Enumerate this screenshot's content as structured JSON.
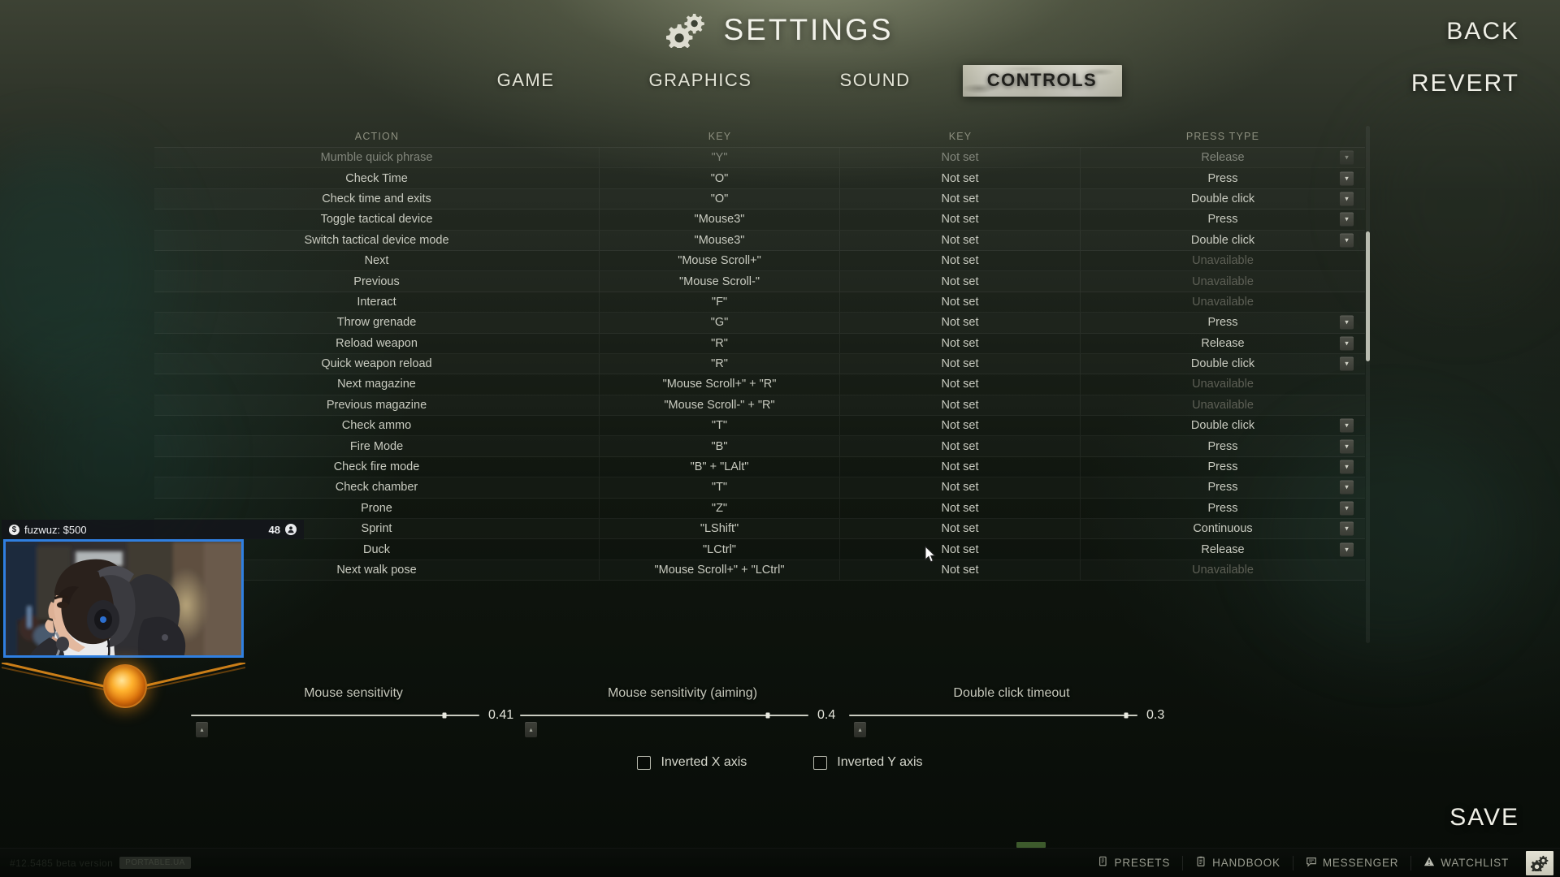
{
  "header": {
    "title": "SETTINGS",
    "gear_icon": "gears-icon"
  },
  "tabs": [
    {
      "label": "GAME",
      "active": false
    },
    {
      "label": "GRAPHICS",
      "active": false
    },
    {
      "label": "SOUND",
      "active": false
    },
    {
      "label": "CONTROLS",
      "active": true
    }
  ],
  "corner_buttons": {
    "back": "BACK",
    "revert": "REVERT",
    "save": "SAVE"
  },
  "table": {
    "columns": [
      "ACTION",
      "KEY",
      "KEY",
      "PRESS TYPE"
    ],
    "not_set_label": "Not set",
    "unavailable_label": "Unavailable",
    "rows": [
      {
        "action": "Mumble quick phrase",
        "key1": "\"Y\"",
        "key2": "Not set",
        "press": "Release",
        "available": true
      },
      {
        "action": "Check Time",
        "key1": "\"O\"",
        "key2": "Not set",
        "press": "Press",
        "available": true
      },
      {
        "action": "Check time and exits",
        "key1": "\"O\"",
        "key2": "Not set",
        "press": "Double click",
        "available": true
      },
      {
        "action": "Toggle tactical device",
        "key1": "\"Mouse3\"",
        "key2": "Not set",
        "press": "Press",
        "available": true
      },
      {
        "action": "Switch tactical device mode",
        "key1": "\"Mouse3\"",
        "key2": "Not set",
        "press": "Double click",
        "available": true
      },
      {
        "action": "Next",
        "key1": "\"Mouse Scroll+\"",
        "key2": "Not set",
        "press": "Unavailable",
        "available": false
      },
      {
        "action": "Previous",
        "key1": "\"Mouse Scroll-\"",
        "key2": "Not set",
        "press": "Unavailable",
        "available": false
      },
      {
        "action": "Interact",
        "key1": "\"F\"",
        "key2": "Not set",
        "press": "Unavailable",
        "available": false
      },
      {
        "action": "Throw grenade",
        "key1": "\"G\"",
        "key2": "Not set",
        "press": "Press",
        "available": true
      },
      {
        "action": "Reload weapon",
        "key1": "\"R\"",
        "key2": "Not set",
        "press": "Release",
        "available": true
      },
      {
        "action": "Quick weapon reload",
        "key1": "\"R\"",
        "key2": "Not set",
        "press": "Double click",
        "available": true
      },
      {
        "action": "Next magazine",
        "key1": "\"Mouse Scroll+\" + \"R\"",
        "key2": "Not set",
        "press": "Unavailable",
        "available": false
      },
      {
        "action": "Previous magazine",
        "key1": "\"Mouse Scroll-\" + \"R\"",
        "key2": "Not set",
        "press": "Unavailable",
        "available": false
      },
      {
        "action": "Check ammo",
        "key1": "\"T\"",
        "key2": "Not set",
        "press": "Double click",
        "available": true
      },
      {
        "action": "Fire Mode",
        "key1": "\"B\"",
        "key2": "Not set",
        "press": "Press",
        "available": true
      },
      {
        "action": "Check fire mode",
        "key1": "\"B\" + \"LAlt\"",
        "key2": "Not set",
        "press": "Press",
        "available": true
      },
      {
        "action": "Check chamber",
        "key1": "\"T\"",
        "key2": "Not set",
        "press": "Press",
        "available": true
      },
      {
        "action": "Prone",
        "key1": "\"Z\"",
        "key2": "Not set",
        "press": "Press",
        "available": true
      },
      {
        "action": "Sprint",
        "key1": "\"LShift\"",
        "key2": "Not set",
        "press": "Continuous",
        "available": true
      },
      {
        "action": "Duck",
        "key1": "\"LCtrl\"",
        "key2": "Not set",
        "press": "Release",
        "available": true
      },
      {
        "action": "Next walk pose",
        "key1": "\"Mouse Scroll+\" + \"LCtrl\"",
        "key2": "Not set",
        "press": "Unavailable",
        "available": false
      }
    ]
  },
  "sliders": [
    {
      "label": "Mouse sensitivity",
      "value": "0.41",
      "fill_pct": 88
    },
    {
      "label": "Mouse sensitivity (aiming)",
      "value": "0.4",
      "fill_pct": 86
    },
    {
      "label": "Double click timeout",
      "value": "0.3",
      "fill_pct": 96
    }
  ],
  "checkboxes": [
    {
      "label": "Inverted X axis",
      "checked": false
    },
    {
      "label": "Inverted Y axis",
      "checked": false
    }
  ],
  "bottom_bar": {
    "version": "#12.5485 beta version",
    "version_chip": "PORTABLE.UA",
    "items": [
      {
        "label": "PRESETS",
        "icon": "presets-icon"
      },
      {
        "label": "HANDBOOK",
        "icon": "handbook-icon"
      },
      {
        "label": "MESSENGER",
        "icon": "messenger-icon"
      },
      {
        "label": "WATCHLIST",
        "icon": "warning-icon"
      }
    ],
    "gear_button_icon": "gear-icon"
  },
  "stream_overlay": {
    "donation_text": "fuzwuz: $500",
    "currency_icon": "dollar-coin-icon",
    "viewer_count": "48",
    "viewer_icon": "viewer-icon"
  },
  "colors": {
    "tab_active_bg": "#e8e7da",
    "tab_active_text": "#20201c",
    "text_primary": "#d8d8cf",
    "text_dim": "#5d5f55",
    "stream_border": "#2f7fe0",
    "orb": "#ffb22e",
    "scrollbar": "#b9bcb0"
  }
}
